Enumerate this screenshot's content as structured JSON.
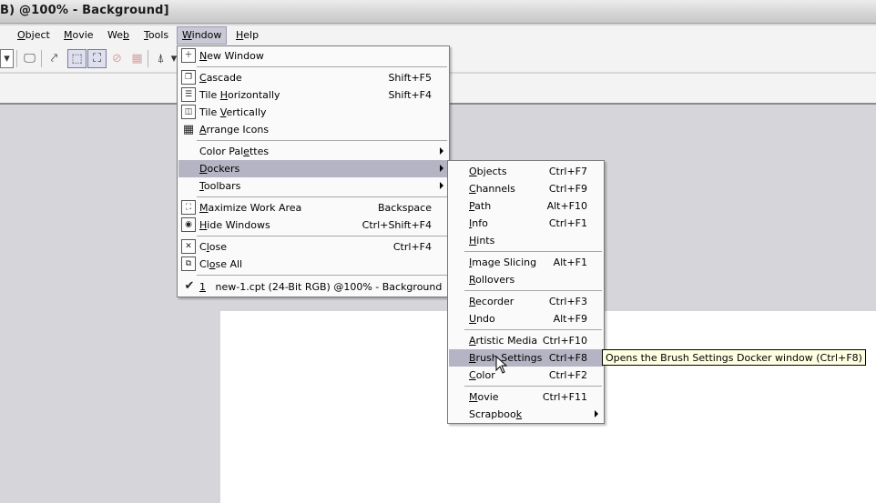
{
  "window": {
    "title": "B) @100% - Background]"
  },
  "menubar": {
    "items": [
      {
        "pre": "",
        "key": "O",
        "post": "bject"
      },
      {
        "pre": "",
        "key": "M",
        "post": "ovie"
      },
      {
        "pre": "We",
        "key": "b",
        "post": ""
      },
      {
        "pre": "",
        "key": "T",
        "post": "ools"
      },
      {
        "pre": "",
        "key": "W",
        "post": "indow"
      },
      {
        "pre": "",
        "key": "H",
        "post": "elp"
      }
    ]
  },
  "window_menu": {
    "new_window": {
      "pre": "",
      "key": "N",
      "post": "ew Window"
    },
    "cascade": {
      "pre": "",
      "key": "C",
      "post": "ascade",
      "shortcut": "Shift+F5"
    },
    "tile_horizontally": {
      "pre": "Tile ",
      "key": "H",
      "post": "orizontally",
      "shortcut": "Shift+F4"
    },
    "tile_vertically": {
      "pre": "Tile ",
      "key": "V",
      "post": "ertically"
    },
    "arrange_icons": {
      "pre": "",
      "key": "A",
      "post": "rrange Icons"
    },
    "color_palettes": {
      "pre": "Color Pal",
      "key": "e",
      "post": "ttes"
    },
    "dockers": {
      "pre": "",
      "key": "D",
      "post": "ockers"
    },
    "toolbars": {
      "pre": "",
      "key": "T",
      "post": "oolbars"
    },
    "maximize_work_area": {
      "pre": "",
      "key": "M",
      "post": "aximize Work Area",
      "shortcut": "Backspace"
    },
    "hide_windows": {
      "pre": "",
      "key": "H",
      "post": "ide Windows",
      "shortcut": "Ctrl+Shift+F4"
    },
    "close": {
      "pre": "C",
      "key": "l",
      "post": "ose",
      "shortcut": "Ctrl+F4"
    },
    "close_all": {
      "pre": "Cl",
      "key": "o",
      "post": "se All"
    },
    "doc_number": "1",
    "doc_name": "new-1.cpt (24-Bit RGB) @100% - Background"
  },
  "dockers_menu": {
    "objects": {
      "pre": "",
      "key": "O",
      "post": "bjects",
      "shortcut": "Ctrl+F7"
    },
    "channels": {
      "pre": "",
      "key": "C",
      "post": "hannels",
      "shortcut": "Ctrl+F9"
    },
    "path": {
      "pre": "",
      "key": "P",
      "post": "ath",
      "shortcut": "Alt+F10"
    },
    "info": {
      "pre": "",
      "key": "I",
      "post": "nfo",
      "shortcut": "Ctrl+F1"
    },
    "hints": {
      "pre": "",
      "key": "H",
      "post": "ints"
    },
    "image_slicing": {
      "pre": "",
      "key": "I",
      "post": "mage Slicing",
      "shortcut": "Alt+F1"
    },
    "rollovers": {
      "pre": "",
      "key": "R",
      "post": "ollovers"
    },
    "recorder": {
      "pre": "",
      "key": "R",
      "post": "ecorder",
      "shortcut": "Ctrl+F3"
    },
    "undo": {
      "pre": "",
      "key": "U",
      "post": "ndo",
      "shortcut": "Alt+F9"
    },
    "artistic_media": {
      "pre": "",
      "key": "A",
      "post": "rtistic Media",
      "shortcut": "Ctrl+F10"
    },
    "brush_settings": {
      "pre": "",
      "key": "B",
      "post": "rush Settings",
      "shortcut": "Ctrl+F8"
    },
    "color": {
      "pre": "",
      "key": "C",
      "post": "olor",
      "shortcut": "Ctrl+F2"
    },
    "movie": {
      "pre": "",
      "key": "M",
      "post": "ovie",
      "shortcut": "Ctrl+F11"
    },
    "scrapbook": {
      "pre": "Scrapboo",
      "key": "k",
      "post": ""
    }
  },
  "tooltip": {
    "text": "Opens the Brush Settings Docker window (Ctrl+F8)"
  },
  "colors": {
    "highlight": "#b4b4c4",
    "menu_bg": "#fafafa",
    "tooltip_bg": "#ffffe1",
    "workspace": "#d6d6da"
  }
}
